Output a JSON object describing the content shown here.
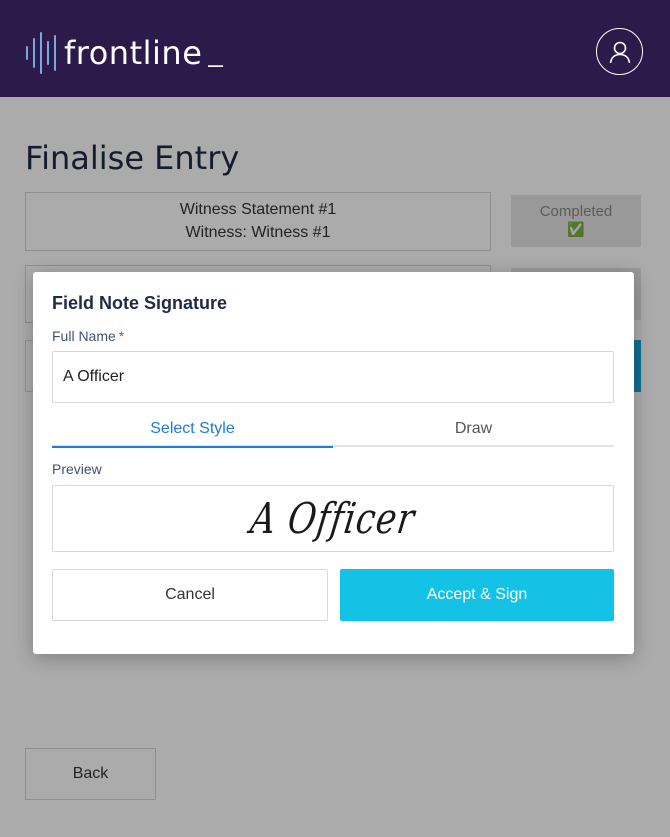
{
  "header": {
    "logo_text": "frontline",
    "logo_cursor": "_",
    "profile_icon": "user-icon"
  },
  "page": {
    "title": "Finalise Entry",
    "entries": [
      {
        "line1": "Witness Statement #1",
        "line2": "Witness: Witness #1",
        "status": "Completed",
        "status_icon": "✅"
      }
    ],
    "back_label": "Back"
  },
  "modal": {
    "title": "Field Note Signature",
    "full_name_label": "Full Name",
    "required_marker": "*",
    "full_name_value": "A Officer",
    "tabs": [
      "Select Style",
      "Draw"
    ],
    "active_tab": "Select Style",
    "preview_label": "Preview",
    "signature_text": "A Officer",
    "cancel_label": "Cancel",
    "accept_label": "Accept & Sign"
  },
  "colors": {
    "header_bg": "#2b1a4a",
    "accent_blue": "#1e7bd8",
    "accept_button": "#14c2e6",
    "required": "#e0303a"
  }
}
